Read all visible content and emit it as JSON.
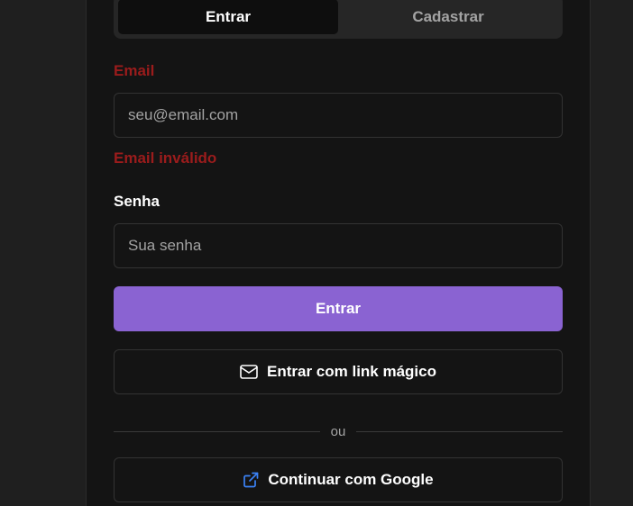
{
  "tabs": [
    {
      "label": "Entrar",
      "active": true
    },
    {
      "label": "Cadastrar",
      "active": false
    }
  ],
  "form": {
    "email_label": "Email",
    "email_placeholder": "seu@email.com",
    "email_error": "Email inválido",
    "password_label": "Senha",
    "password_placeholder": "Sua senha",
    "submit_label": "Entrar"
  },
  "magic_link": {
    "label": "Entrar com link mágico",
    "icon": "mail-icon"
  },
  "divider": {
    "label": "ou"
  },
  "google": {
    "label": "Continuar com Google",
    "icon": "external-link-icon"
  },
  "colors": {
    "primary": "#8a63d2",
    "error": "#9b1c1c",
    "link_icon": "#3b82f6"
  }
}
